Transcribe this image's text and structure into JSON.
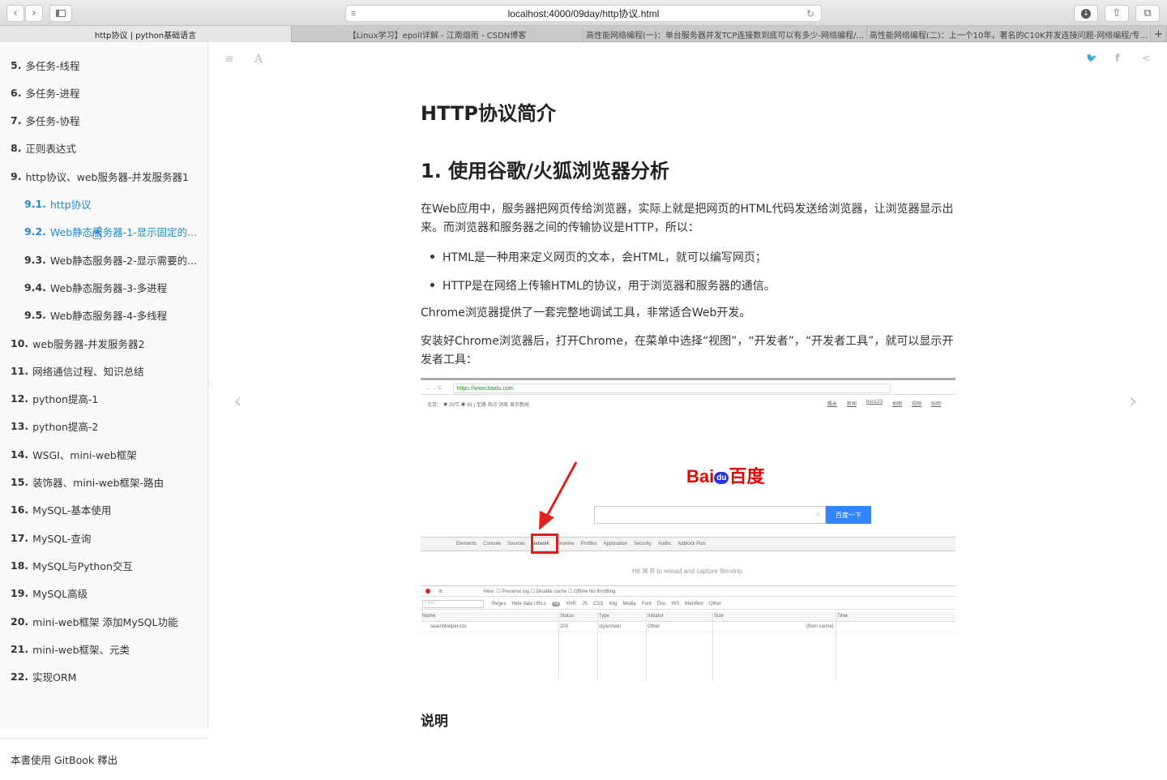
{
  "browser": {
    "url": "localhost:4000/09day/http协议.html",
    "tabs": [
      "http协议 | python基础语言",
      "【Linux学习】epoll详解 - 江南烟雨 - CSDN博客",
      "高性能网络编程(一)：单台服务器并发TCP连接数到底可以有多少-网络编程/...",
      "高性能网络编程(二)：上一个10年，著名的C10K并发连接问题-网络编程/专..."
    ]
  },
  "sidebar": {
    "items": [
      {
        "num": "5.",
        "label": "多任务-线程"
      },
      {
        "num": "6.",
        "label": "多任务-进程"
      },
      {
        "num": "7.",
        "label": "多任务-协程"
      },
      {
        "num": "8.",
        "label": "正则表达式"
      },
      {
        "num": "9.",
        "label": "http协议、web服务器-并发服务器1"
      },
      {
        "num": "9.1.",
        "label": "http协议"
      },
      {
        "num": "9.2.",
        "label": "Web静态服务器-1-显示固定的..."
      },
      {
        "num": "9.3.",
        "label": "Web静态服务器-2-显示需要的..."
      },
      {
        "num": "9.4.",
        "label": "Web静态服务器-3-多进程"
      },
      {
        "num": "9.5.",
        "label": "Web静态服务器-4-多线程"
      },
      {
        "num": "10.",
        "label": "web服务器-并发服务器2"
      },
      {
        "num": "11.",
        "label": "网络通信过程、知识总结"
      },
      {
        "num": "12.",
        "label": "python提高-1"
      },
      {
        "num": "13.",
        "label": "python提高-2"
      },
      {
        "num": "14.",
        "label": "WSGI、mini-web框架"
      },
      {
        "num": "15.",
        "label": "装饰器、mini-web框架-路由"
      },
      {
        "num": "16.",
        "label": "MySQL-基本使用"
      },
      {
        "num": "17.",
        "label": "MySQL-查询"
      },
      {
        "num": "18.",
        "label": "MySQL与Python交互"
      },
      {
        "num": "19.",
        "label": "MySQL高级"
      },
      {
        "num": "20.",
        "label": "mini-web框架 添加MySQL功能"
      },
      {
        "num": "21.",
        "label": "mini-web框架、元类"
      },
      {
        "num": "22.",
        "label": "实现ORM"
      }
    ],
    "footer": "本書使用 GitBook 釋出"
  },
  "article": {
    "title": "HTTP协议简介",
    "section": "1. 使用谷歌/火狐浏览器分析",
    "para1": "在Web应用中，服务器把网页传给浏览器，实际上就是把网页的HTML代码发送给浏览器，让浏览器显示出来。而浏览器和服务器之间的传输协议是HTTP，所以：",
    "bullets": [
      "HTML是一种用来定义网页的文本，会HTML，就可以编写网页；",
      "HTTP是在网络上传输HTML的协议，用于浏览器和服务器的通信。"
    ],
    "para2": "Chrome浏览器提供了一套完整地调试工具，非常适合Web开发。",
    "para3": "安装好Chrome浏览器后，打开Chrome，在菜单中选择“视图”，“开发者”，“开发者工具”，就可以显示开发者工具：",
    "heading_note": "说明"
  },
  "screenshot": {
    "url": "https://www.baidu.com",
    "weather": "北京：  ☀ 20℃  ◉ 91  |  宝路  热点  消息  显示新闻",
    "links": [
      "糯米",
      "新闻",
      "hao123",
      "地图",
      "视频",
      "贴吧"
    ],
    "logo_bai": "Bai",
    "logo_du": "du",
    "logo_cn": "百度",
    "search_button": "百度一下",
    "devtools_tabs": [
      "Elements",
      "Console",
      "Sources",
      "Network",
      "Timeline",
      "Profiles",
      "Application",
      "Security",
      "Audits",
      "Adblock Plus"
    ],
    "hint": "Hit ⌘ R to reload and capture filmstrip.",
    "toolbar": "View:     ☐ Preserve log   ☐ Disable cache   ☐ Offline   No throttling",
    "filter_row": [
      "Regex",
      "Hide data URLs",
      "All",
      "XHR",
      "JS",
      "CSS",
      "Img",
      "Media",
      "Font",
      "Doc",
      "WS",
      "Manifest",
      "Other"
    ],
    "filter_placeholder": "Filter",
    "columns": [
      "Name",
      "Status",
      "Type",
      "Initiator",
      "Size",
      "Time"
    ],
    "row": [
      "searchhelper.css",
      "200",
      "stylesheet",
      "Other",
      "(from cache)",
      ""
    ]
  }
}
